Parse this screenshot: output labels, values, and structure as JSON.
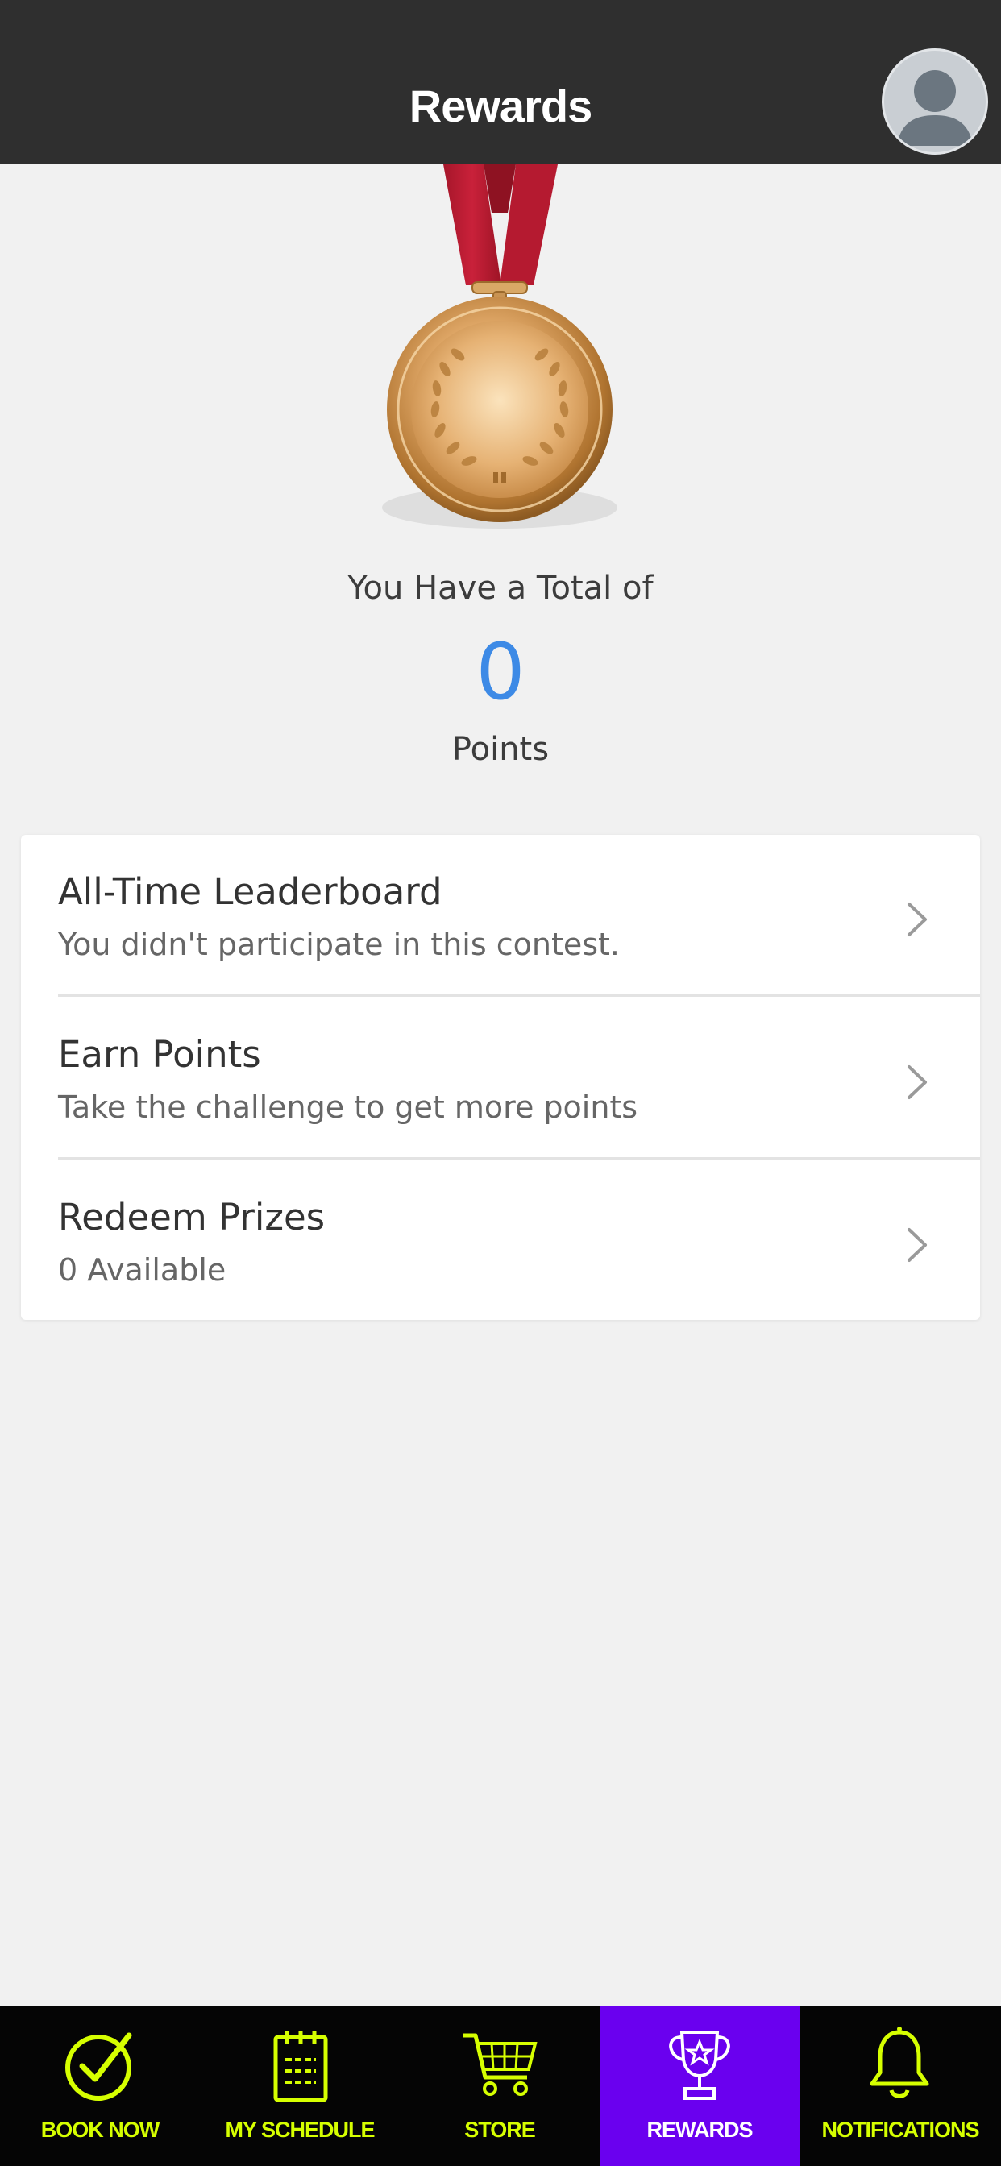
{
  "header": {
    "title": "Rewards"
  },
  "summary": {
    "total_label": "You Have a Total of",
    "points_value": "0",
    "points_label": "Points"
  },
  "menu": [
    {
      "title": "All-Time Leaderboard",
      "subtitle": "You didn't participate in this contest."
    },
    {
      "title": "Earn Points",
      "subtitle": "Take the challenge to get more points"
    },
    {
      "title": "Redeem Prizes",
      "subtitle": "0 Available"
    }
  ],
  "tabbar": {
    "items": [
      {
        "label": "BOOK NOW",
        "icon": "check-circle-icon"
      },
      {
        "label": "MY SCHEDULE",
        "icon": "calendar-icon"
      },
      {
        "label": "STORE",
        "icon": "cart-icon"
      },
      {
        "label": "REWARDS",
        "icon": "trophy-icon",
        "active": true
      },
      {
        "label": "NOTIFICATIONS",
        "icon": "bell-icon"
      }
    ]
  },
  "colors": {
    "header_bg": "#2f2f2f",
    "points_blue": "#3d8ae6",
    "tab_active_bg": "#6a00ef",
    "tab_accent": "#d6ff00"
  }
}
